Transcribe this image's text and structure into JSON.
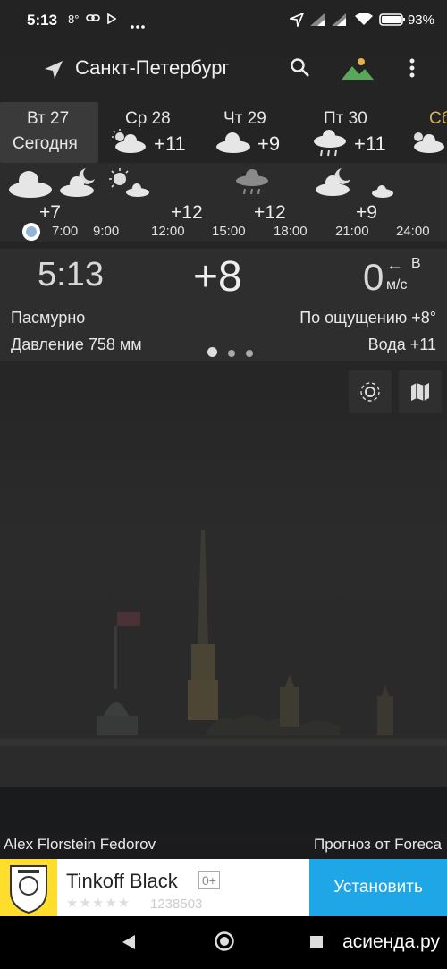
{
  "status": {
    "time": "5:13",
    "temp_badge": "8°",
    "battery": "93%",
    "icons": [
      "link-icon",
      "play-icon",
      "more-dots-icon",
      "location-arrow-icon",
      "signal-icon",
      "wifi-icon",
      "battery-icon"
    ]
  },
  "toolbar": {
    "city": "Санкт-Петербург",
    "icons": [
      "navigation-icon",
      "search-icon",
      "landscape-icon",
      "more-vert-icon"
    ]
  },
  "days": [
    {
      "name": "Вт 27",
      "sub": "Сегодня",
      "temp": ""
    },
    {
      "name": "Ср 28",
      "sub": "",
      "temp": "+11"
    },
    {
      "name": "Чт 29",
      "sub": "",
      "temp": "+9"
    },
    {
      "name": "Пт 30",
      "sub": "",
      "temp": "+11"
    },
    {
      "name": "Сб",
      "sub": "",
      "temp": ""
    }
  ],
  "hourly": {
    "temps": [
      "+7",
      "+12",
      "+12",
      "+9"
    ],
    "times": [
      "7:00",
      "9:00",
      "12:00",
      "15:00",
      "18:00",
      "21:00",
      "24:00"
    ]
  },
  "current": {
    "time": "5:13",
    "temp": "+8",
    "wind_speed": "0",
    "wind_arrow": "←",
    "wind_dir": "В",
    "wind_unit": "м/с",
    "condition": "Пасмурно",
    "feels_like": "По ощущению +8°",
    "pressure": "Давление 758 мм",
    "water": "Вода +11"
  },
  "credits": {
    "photo": "Alex Florstein Fedorov",
    "provider": "Прогноз от Foreca"
  },
  "ad": {
    "name": "Tinkoff Black",
    "age": "0+",
    "stars": "★★★★★",
    "rating_count": "1238503",
    "install": "Установить"
  },
  "navbar": {
    "watermark": "асиенда.ру"
  },
  "colors": {
    "accent_gold": "#d8b15a",
    "install_blue": "#1fa6e6",
    "tinkoff_yellow": "#ffdd2d"
  }
}
